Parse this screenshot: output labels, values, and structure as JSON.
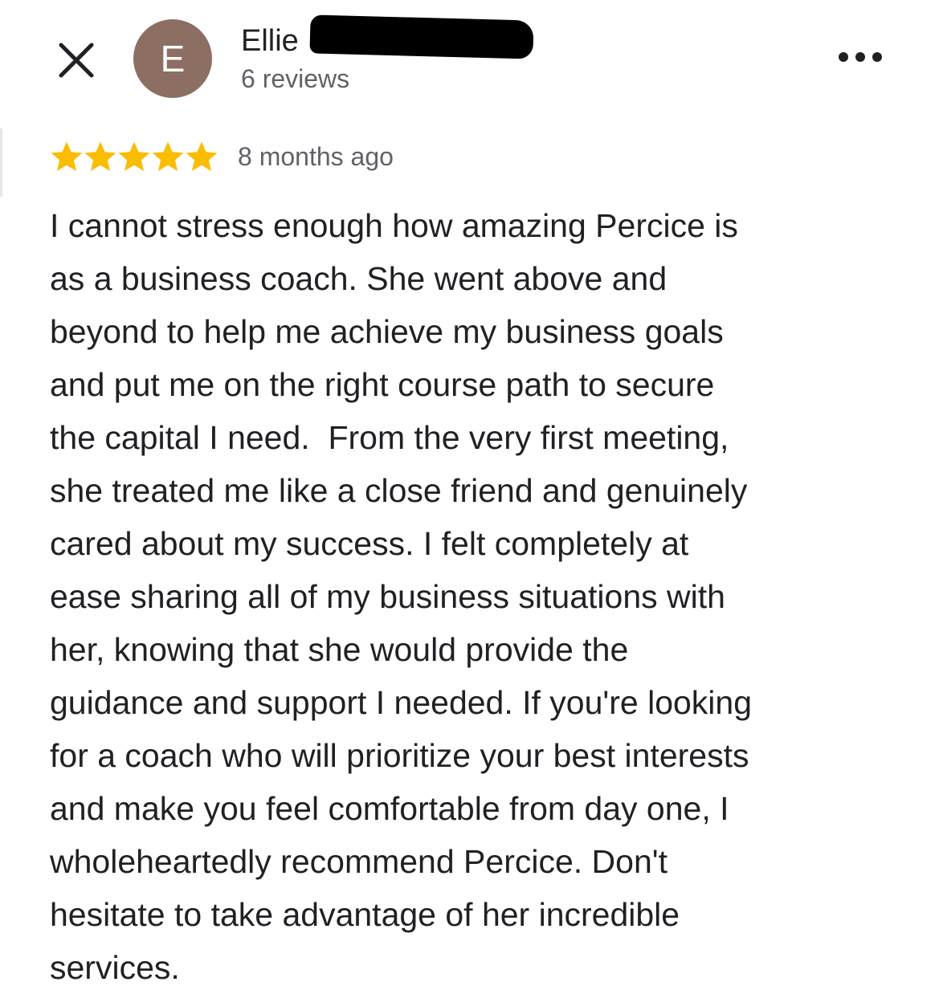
{
  "header": {
    "close_icon": "close-icon",
    "avatar_letter": "E",
    "avatar_color": "#8d6e63",
    "reviewer_name": "Ellie",
    "review_count": "6 reviews",
    "more_icon": "more-horizontal-icon"
  },
  "review": {
    "rating": 5,
    "rating_max": 5,
    "star_color": "#fbbc04",
    "date": "8 months ago",
    "text_lines": [
      "I cannot stress enough how amazing Percice is",
      "as a business coach. She went above and",
      "beyond to help me achieve my business goals",
      "and put me on the right course path to secure",
      "the capital I need.  From the very first meeting,",
      "she treated me like a close friend and genuinely",
      "cared about my success. I felt completely at",
      "ease sharing all of my business situations with",
      "her, knowing that she would provide the",
      "guidance and support I needed. If you're looking",
      "for a coach who will prioritize your best interests",
      "and make you feel comfortable from day one, I",
      "wholeheartedly recommend Percice. Don't",
      "hesitate to take advantage of her incredible",
      "services."
    ]
  }
}
